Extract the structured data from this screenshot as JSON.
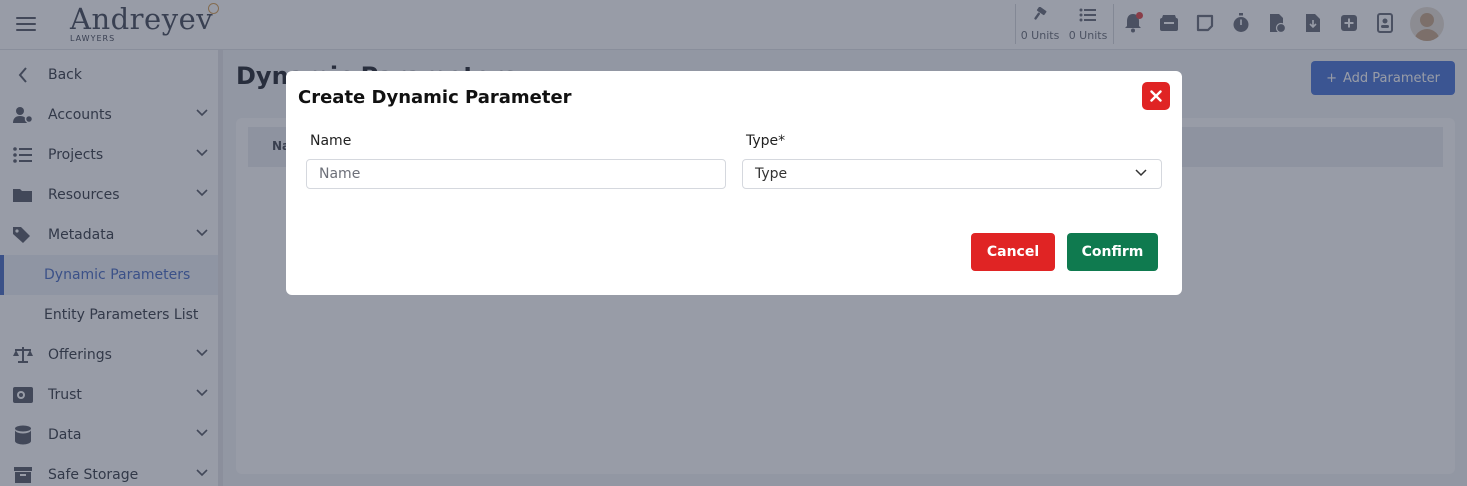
{
  "header": {
    "brand_name": "Andreyev",
    "brand_sub": "LAWYERS",
    "units": [
      {
        "icon": "gavel-icon",
        "label": "0 Units"
      },
      {
        "icon": "list-icon",
        "label": "0 Units"
      }
    ],
    "toolbar_icons": [
      "bell-icon",
      "inbox-icon",
      "note-icon",
      "stopwatch-icon",
      "invoice-icon",
      "document-download-icon",
      "plus-square-icon",
      "contact-card-icon"
    ]
  },
  "sidebar": {
    "back": "Back",
    "items": [
      {
        "label": "Accounts",
        "icon": "user-gear-icon"
      },
      {
        "label": "Projects",
        "icon": "list-icon"
      },
      {
        "label": "Resources",
        "icon": "folder-icon"
      },
      {
        "label": "Metadata",
        "icon": "tags-icon"
      },
      {
        "label": "Dynamic Parameters",
        "icon": "",
        "active": true
      },
      {
        "label": "Entity Parameters List",
        "icon": ""
      },
      {
        "label": "Offerings",
        "icon": "scale-icon"
      },
      {
        "label": "Trust",
        "icon": "vault-icon"
      },
      {
        "label": "Data",
        "icon": "database-icon"
      },
      {
        "label": "Safe Storage",
        "icon": "archive-icon"
      }
    ]
  },
  "main": {
    "page_title": "Dynamic Parameters",
    "add_button": "Add Parameter",
    "table_header_first": "Na"
  },
  "modal": {
    "title": "Create Dynamic Parameter",
    "name_label": "Name",
    "name_placeholder": "Name",
    "type_label": "Type*",
    "type_value": "Type",
    "cancel_label": "Cancel",
    "confirm_label": "Confirm"
  },
  "colors": {
    "accent": "#4d6fc3",
    "danger": "#e02424",
    "success": "#0f7a4f"
  }
}
